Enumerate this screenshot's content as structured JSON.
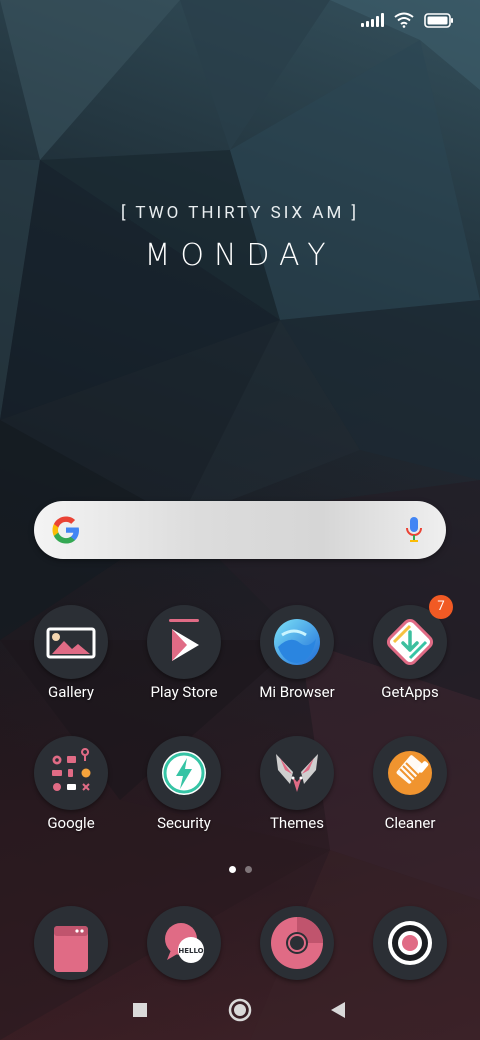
{
  "status_bar": {
    "signal_icon": "signal-icon",
    "wifi_icon": "wifi-icon",
    "battery_icon": "battery-icon"
  },
  "clock_widget": {
    "time_text": "[ TWO THIRTY SIX AM ]",
    "day_text": "MONDAY"
  },
  "search_bar": {
    "logo_icon": "google-g-icon",
    "mic_icon": "mic-icon"
  },
  "apps_row1": [
    {
      "label": "Gallery",
      "icon": "gallery-icon"
    },
    {
      "label": "Play Store",
      "icon": "play-store-icon"
    },
    {
      "label": "Mi Browser",
      "icon": "mi-browser-icon"
    },
    {
      "label": "GetApps",
      "icon": "getapps-icon",
      "badge": "7"
    }
  ],
  "apps_row2": [
    {
      "label": "Google",
      "icon": "google-folder-icon"
    },
    {
      "label": "Security",
      "icon": "security-icon"
    },
    {
      "label": "Themes",
      "icon": "themes-icon"
    },
    {
      "label": "Cleaner",
      "icon": "cleaner-icon"
    }
  ],
  "page_indicator": {
    "pages": 2,
    "active": 1
  },
  "dock": [
    {
      "icon": "phone-app-icon"
    },
    {
      "icon": "messages-hello-icon"
    },
    {
      "icon": "browser-circle-icon"
    },
    {
      "icon": "camera-icon"
    }
  ],
  "nav_bar": {
    "recent_icon": "recents-square-icon",
    "home_icon": "home-circle-icon",
    "back_icon": "back-triangle-icon"
  },
  "colors": {
    "accent_pink": "#e06b85",
    "badge_orange": "#f15a24",
    "icon_background": "#2b2f35"
  }
}
